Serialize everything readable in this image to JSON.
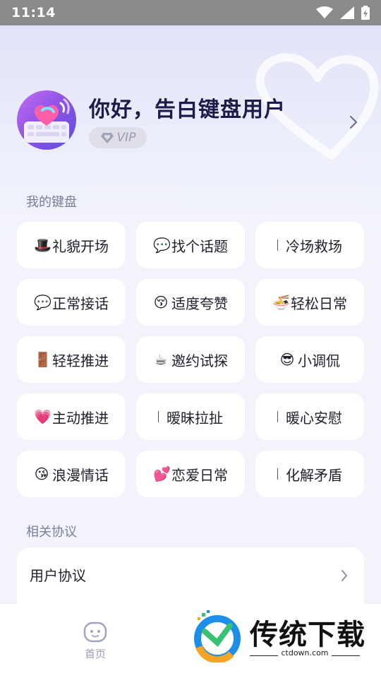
{
  "status_bar": {
    "time": "11:14"
  },
  "profile": {
    "greeting": "你好，告白键盘用户",
    "vip_label": "VIP"
  },
  "keyboard_section": {
    "title": "我的键盘",
    "items": [
      {
        "emoji": "🎩",
        "label": "礼貌开场"
      },
      {
        "emoji": "💬",
        "label": "找个话题"
      },
      {
        "emoji": "",
        "label": "冷场救场"
      },
      {
        "emoji": "💬",
        "label": "正常接话"
      },
      {
        "emoji": "😚",
        "label": "适度夸赞"
      },
      {
        "emoji": "🍜",
        "label": "轻松日常"
      },
      {
        "emoji": "🚪",
        "label": "轻轻推进"
      },
      {
        "emoji": "☕",
        "label": "邀约试探"
      },
      {
        "emoji": "😎",
        "label": "小调侃"
      },
      {
        "emoji": "💗",
        "label": "主动推进"
      },
      {
        "emoji": "",
        "label": "暧昧拉扯"
      },
      {
        "emoji": "",
        "label": "暖心安慰"
      },
      {
        "emoji": "😘",
        "label": "浪漫情话"
      },
      {
        "emoji": "💕",
        "label": "恋爱日常"
      },
      {
        "emoji": "",
        "label": "化解矛盾"
      }
    ]
  },
  "agreements_section": {
    "title": "相关协议",
    "items": [
      {
        "label": "用户协议"
      }
    ]
  },
  "bottom_nav": {
    "home_label": "首页"
  },
  "watermark": {
    "text": "传统下载",
    "url": "ctdown.com"
  },
  "colors": {
    "accent": "#8a52e6",
    "text_dark": "#1e1b4a",
    "section_title": "#7b7e9a"
  }
}
